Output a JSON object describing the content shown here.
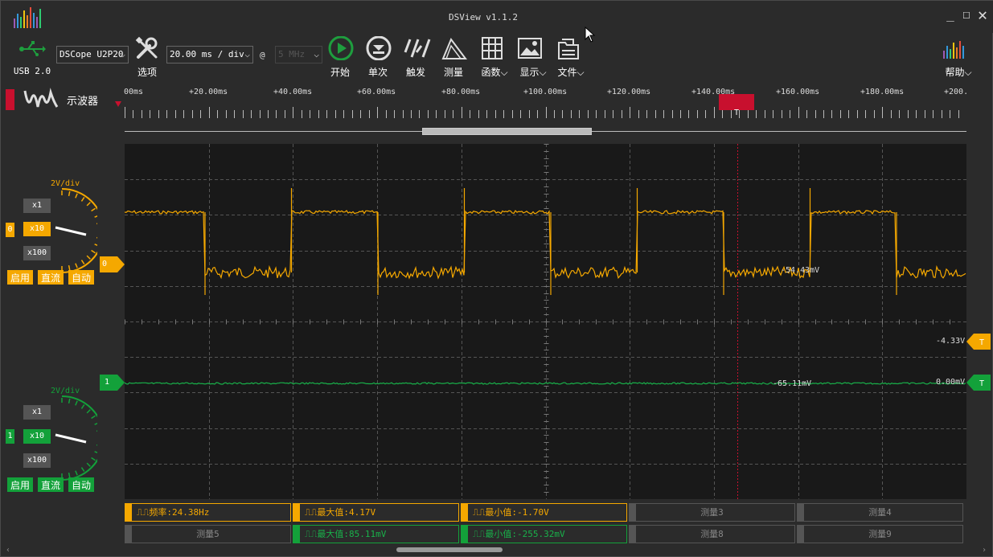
{
  "app": {
    "title": "DSView v1.1.2"
  },
  "device": {
    "usb_label": "USB 2.0",
    "device_name": "DSCope U2P20"
  },
  "toolbar": {
    "options_label": "选项",
    "timebase_value": "20.00 ms / div",
    "at_symbol": "@",
    "samplerate_value": "5 MHz",
    "start_label": "开始",
    "single_label": "单次",
    "trigger_label": "触发",
    "measure_label": "测量",
    "math_label": "函数",
    "display_label": "显示",
    "file_label": "文件",
    "help_label": "帮助"
  },
  "mode": {
    "label": "示波器"
  },
  "timeline": {
    "labels": [
      "00ms",
      "+20.00ms",
      "+40.00ms",
      "+60.00ms",
      "+80.00ms",
      "+100.00ms",
      "+120.00ms",
      "+140.00ms",
      "+160.00ms",
      "+180.00ms",
      "+200."
    ],
    "trigger_marker": "T"
  },
  "channels": [
    {
      "index": "0",
      "vdiv": "2V/div",
      "probe": [
        "x1",
        "x10",
        "x100"
      ],
      "probe_selected": "x10",
      "modes": [
        "启用",
        "直流",
        "自动"
      ],
      "color": "#f5a800"
    },
    {
      "index": "1",
      "vdiv": "2V/div",
      "probe": [
        "x1",
        "x10",
        "x100"
      ],
      "probe_selected": "x10",
      "modes": [
        "启用",
        "直流",
        "自动"
      ],
      "color": "#13a13a"
    }
  ],
  "scope": {
    "ch0_marker": "0",
    "ch1_marker": "1",
    "ch0_cursor_value": "-54.43mV",
    "ch1_cursor_value": "-65.11mV",
    "trig_level_ch0": "-4.33V",
    "trig_level_ch1": "0.00mV",
    "trig_marker": "T"
  },
  "measurements": [
    {
      "label": "频率:24.38Hz",
      "style": "y"
    },
    {
      "label": "最大值:4.17V",
      "style": "y"
    },
    {
      "label": "最小值:-1.70V",
      "style": "y"
    },
    {
      "label": "测量3",
      "style": "gray"
    },
    {
      "label": "测量4",
      "style": "gray"
    },
    {
      "label": "测量5",
      "style": "gray"
    },
    {
      "label": "最大值:85.11mV",
      "style": "g"
    },
    {
      "label": "最小值:-255.32mV",
      "style": "g"
    },
    {
      "label": "测量8",
      "style": "gray"
    },
    {
      "label": "测量9",
      "style": "gray"
    }
  ]
}
